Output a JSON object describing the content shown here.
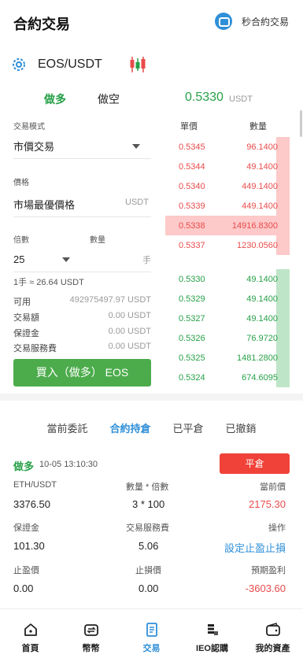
{
  "header": {
    "title": "合約交易",
    "right_link": "秒合約交易"
  },
  "symbol": {
    "name": "EOS/USDT"
  },
  "side_tabs": [
    {
      "label": "做多",
      "active": true
    },
    {
      "label": "做空",
      "active": false
    }
  ],
  "last_price": {
    "value": "0.5330",
    "unit": "USDT"
  },
  "form": {
    "mode_label": "交易模式",
    "mode_value": "市價交易",
    "price_label": "價格",
    "price_value": "市場最優價格",
    "price_unit": "USDT",
    "leverage_label": "倍數",
    "leverage_value": "25",
    "qty_label": "數量",
    "qty_unit": "手",
    "lot_note": "1手 ≈ 26.64 USDT",
    "info": [
      {
        "k": "可用",
        "v": "492975497.97 USDT"
      },
      {
        "k": "交易額",
        "v": "0.00 USDT"
      },
      {
        "k": "保證金",
        "v": "0.00 USDT"
      },
      {
        "k": "交易服務費",
        "v": "0.00 USDT"
      }
    ],
    "buy_button": "買入（做多） EOS"
  },
  "orderbook": {
    "price_header": "單價",
    "qty_header": "數量",
    "asks": [
      {
        "p": "0.5345",
        "q": "96.1400",
        "depth": 0.1
      },
      {
        "p": "0.5344",
        "q": "49.1400",
        "depth": 0.1
      },
      {
        "p": "0.5340",
        "q": "449.1400",
        "depth": 0.1
      },
      {
        "p": "0.5339",
        "q": "449.1400",
        "depth": 0.1
      },
      {
        "p": "0.5338",
        "q": "14916.8300",
        "depth": 1.0
      },
      {
        "p": "0.5337",
        "q": "1230.0560",
        "depth": 0.1
      }
    ],
    "bids": [
      {
        "p": "0.5330",
        "q": "49.1400",
        "depth": 0.1
      },
      {
        "p": "0.5329",
        "q": "49.1400",
        "depth": 0.1
      },
      {
        "p": "0.5327",
        "q": "49.1400",
        "depth": 0.1
      },
      {
        "p": "0.5326",
        "q": "76.9720",
        "depth": 0.1
      },
      {
        "p": "0.5325",
        "q": "1481.2800",
        "depth": 0.1
      },
      {
        "p": "0.5324",
        "q": "674.6095",
        "depth": 0.1
      }
    ],
    "ask_color": "#fdc9c9",
    "bid_color": "#bfe5c8"
  },
  "order_tabs": [
    {
      "label": "當前委託",
      "active": false
    },
    {
      "label": "合約持倉",
      "active": true
    },
    {
      "label": "已平倉",
      "active": false
    },
    {
      "label": "已撤銷",
      "active": false
    }
  ],
  "position": {
    "direction": "做多",
    "time": "10-05 13:10:30",
    "close_button": "平倉",
    "pair_label": "ETH/USDT",
    "qty_mult_label": "數量 * 倍數",
    "cur_price_label": "當前價",
    "open_price": "3376.50",
    "qty_mult": "3 * 100",
    "cur_price": "2175.30",
    "margin_label": "保證金",
    "fee_label": "交易服務費",
    "op_label": "操作",
    "margin": "101.30",
    "fee": "5.06",
    "op_link": "設定止盈止損",
    "tp_label": "止盈價",
    "sl_label": "止損價",
    "pnl_label": "預期盈利",
    "tp": "0.00",
    "sl": "0.00",
    "pnl": "-3603.60"
  },
  "bottom_nav": [
    {
      "label": "首頁",
      "icon": "home-icon",
      "active": false
    },
    {
      "label": "幣幣",
      "icon": "wallet-swap-icon",
      "active": false
    },
    {
      "label": "交易",
      "icon": "trade-doc-icon",
      "active": true
    },
    {
      "label": "IEO認購",
      "icon": "coins-stack-icon",
      "active": false
    },
    {
      "label": "我的資產",
      "icon": "assets-wallet-icon",
      "active": false
    }
  ],
  "colors": {
    "green": "#27a048",
    "red": "#e94b4b",
    "blue": "#2f8fd8"
  }
}
